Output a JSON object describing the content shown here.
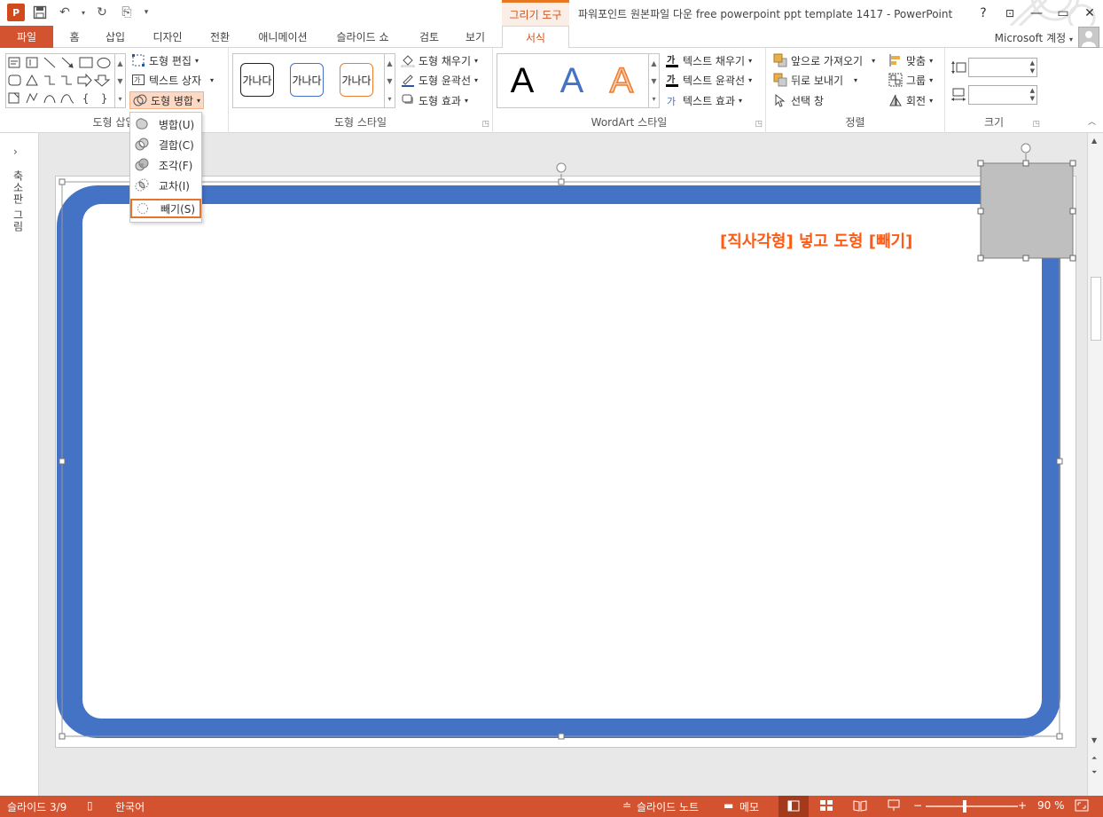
{
  "titlebar": {
    "context_group": "그리기 도구",
    "window_title": "파워포인트 원본파일 다운 free powerpoint ppt template 1417 - PowerPoint",
    "help": "?",
    "minimize": "—",
    "restore": "▭",
    "close": "✕"
  },
  "tabs": {
    "file": "파일",
    "home": "홈",
    "insert": "삽입",
    "design": "디자인",
    "transitions": "전환",
    "animations": "애니메이션",
    "slideshow": "슬라이드 쇼",
    "review": "검토",
    "view": "보기",
    "format": "서식",
    "account": "Microsoft 계정"
  },
  "ribbon": {
    "insert_shapes": {
      "label": "도형 삽입",
      "edit_shape": "도형 편집",
      "text_box": "텍스트 상자",
      "merge_shapes": "도형 병합"
    },
    "shape_styles": {
      "label": "도형 스타일",
      "sample_text": "가나다",
      "fill": "도형 채우기",
      "outline": "도형 윤곽선",
      "effects": "도형 효과"
    },
    "wordart": {
      "label": "WordArt 스타일",
      "sample": "A",
      "text_fill": "텍스트 채우기",
      "text_outline": "텍스트 윤곽선",
      "text_effects": "텍스트 효과"
    },
    "arrange": {
      "label": "정렬",
      "bring_forward": "앞으로 가져오기",
      "send_backward": "뒤로 보내기",
      "selection_pane": "선택 창",
      "align": "맞춤",
      "group": "그룹",
      "rotate": "회전"
    },
    "size": {
      "label": "크기",
      "height": "",
      "width": ""
    }
  },
  "merge_menu": {
    "items": [
      {
        "label": "병합(U)",
        "icon": "union-icon"
      },
      {
        "label": "결합(C)",
        "icon": "combine-icon"
      },
      {
        "label": "조각(F)",
        "icon": "fragment-icon"
      },
      {
        "label": "교차(I)",
        "icon": "intersect-icon"
      },
      {
        "label": "빼기(S)",
        "icon": "subtract-icon"
      }
    ],
    "selected": "빼기(S)"
  },
  "leftpane": {
    "label": "축소판 그림"
  },
  "slide": {
    "annotation": "[직사각형] 넣고 도형 [빼기]",
    "frame_color": "#4472c4",
    "rect_fill": "#bfbfbf"
  },
  "statusbar": {
    "slide_counter": "슬라이드 3/9",
    "language": "한국어",
    "notes": "슬라이드 노트",
    "comments": "메모",
    "zoom": "90 %"
  },
  "colors": {
    "accent": "#d35230",
    "highlight": "#e8732a",
    "annotation": "#ff5a14"
  }
}
